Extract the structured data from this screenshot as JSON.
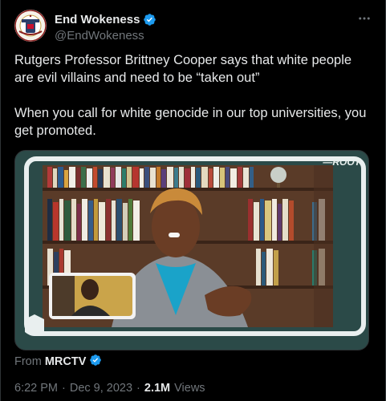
{
  "tweet": {
    "author": {
      "display_name": "End Wokeness",
      "handle": "@EndWokeness",
      "avatar_text": "CONSTANT VIGILANCE"
    },
    "text_line1": "Rutgers Professor Brittney Cooper says that white people are evil villains and need to be “taken out”",
    "text_line2": "When you call for white genocide in our top universities, you get promoted.",
    "media": {
      "watermark": "—ROOT"
    },
    "source_prefix": "From",
    "source_name": "MRCTV",
    "time": "6:22 PM",
    "separator1": "·",
    "date": "Dec 9, 2023",
    "separator2": "·",
    "views_count": "2.1M",
    "views_label": "Views"
  },
  "colors": {
    "background": "#000000",
    "text": "#e7e9ea",
    "muted": "#71767b",
    "verified": "#1d9bf0"
  },
  "icons": {
    "verified": "verified-badge-icon",
    "more": "more-dots-icon"
  }
}
